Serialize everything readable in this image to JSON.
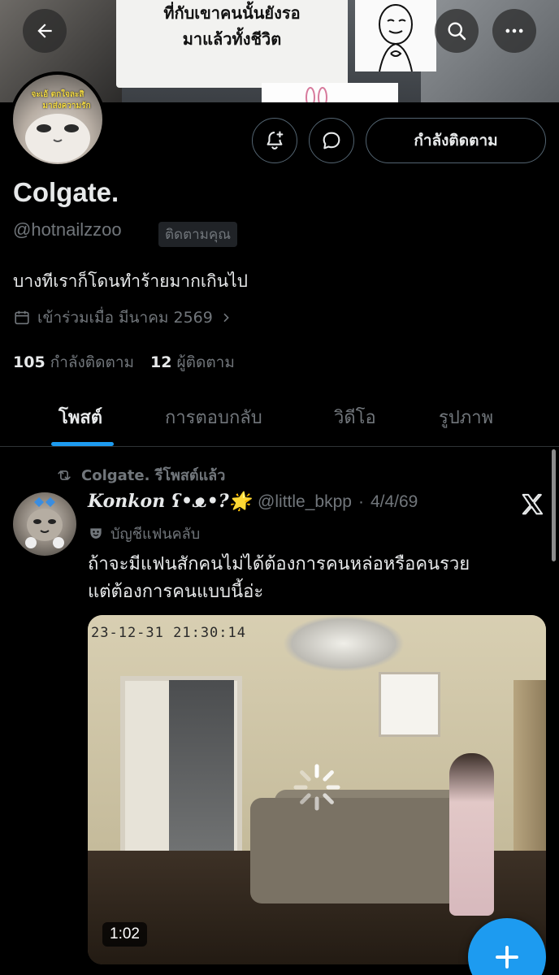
{
  "banner": {
    "sign_lines": [
      "ที่กับเขาคนนั้นยังรอ",
      "มาแล้วทั้งชีวิต"
    ]
  },
  "avatar": {
    "caption_lines": [
      "จะเอ้ ตกใจละสิ",
      "มาส่งความรัก"
    ]
  },
  "header": {
    "back_icon": "arrow-left-icon",
    "search_icon": "search-icon",
    "more_icon": "more-horizontal-icon"
  },
  "actions": {
    "notify_icon": "bell-plus-icon",
    "message_icon": "message-icon",
    "follow_label": "กำลังติดตาม"
  },
  "profile": {
    "name": "Colgate.",
    "handle": "@hotnailzzoo",
    "follows_you": "ติดตามคุณ",
    "bio": "บางทีเราก็โดนทำร้ายมากเกินไป",
    "joined": "เข้าร่วมเมื่อ มีนาคม 2569",
    "following_count": "105",
    "following_label": "กำลังติดตาม",
    "followers_count": "12",
    "followers_label": "ผู้ติดตาม"
  },
  "tabs": [
    {
      "label": "โพสต์",
      "active": true
    },
    {
      "label": "การตอบกลับ",
      "active": false
    },
    {
      "label": "วิดีโอ",
      "active": false
    },
    {
      "label": "รูปภาพ",
      "active": false
    }
  ],
  "post": {
    "repost_label": "Colgate. รีโพสต์แล้ว",
    "author_name": "Konkon ʕ•ᴥ•?🌟",
    "author_handle": "@little_bkpp",
    "date": "4/4/69",
    "badge": "บัญชีแฟนคลับ",
    "text_lines": [
      "ถ้าจะมีแฟนสักคนไม่ได้ต้องการคนหล่อหรือคนรวย",
      "แต่ต้องการคนแบบนี้อ่ะ"
    ],
    "video": {
      "timestamp": "23-12-31 21:30:14",
      "duration": "1:02"
    }
  },
  "fab": {
    "icon": "plus-icon"
  },
  "colors": {
    "accent": "#1d9bf0",
    "text_primary": "#e7e9ea",
    "text_secondary": "#71767b",
    "border": "#536471",
    "background": "#000000"
  }
}
